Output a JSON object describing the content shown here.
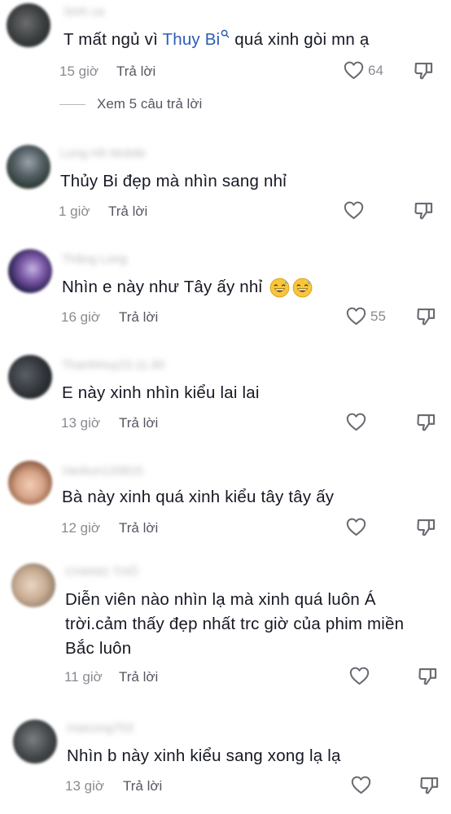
{
  "comments": [
    {
      "username": "Sinh ca",
      "text_before": "T mất ngủ vì ",
      "mention": "Thuy Bi",
      "text_after": " quá xinh gòi mn ạ",
      "time": "15 giờ",
      "reply_label": "Trả lời",
      "likes": "64",
      "view_replies": "Xem 5 câu trả lời"
    },
    {
      "username": "Long Hồ Mobile",
      "text": "Thủy Bi đẹp mà nhìn sang nhỉ",
      "time": "1 giờ",
      "reply_label": "Trả lời",
      "likes": ""
    },
    {
      "username": "Thăng Long",
      "text": "Nhìn e này như Tây ấy nhỉ",
      "emojis": [
        "grinning-sweat-emoji",
        "grinning-sweat-emoji"
      ],
      "time": "16 giờ",
      "reply_label": "Trả lời",
      "likes": "55"
    },
    {
      "username": "ThanhHuy23.11.90",
      "text": "E này xinh nhìn kiểu lai lai",
      "time": "13 giờ",
      "reply_label": "Trả lời",
      "likes": ""
    },
    {
      "username": "Vankun120815",
      "text": "Bà này xinh quá xinh kiểu tây tây ấy",
      "time": "12 giờ",
      "reply_label": "Trả lời",
      "likes": ""
    },
    {
      "username": "CHANG THỎ",
      "text_lines": [
        "Diễn viên nào nhìn lạ mà xinh quá luôn Á",
        "trời.cảm thấy đẹp nhất trc giờ của phim miền",
        "Bắc luôn"
      ],
      "time": "11 giờ",
      "reply_label": "Trả lời",
      "likes": ""
    },
    {
      "username": "maicong753",
      "text": "Nhìn b này xinh kiểu sang xong lạ lạ",
      "time": "13 giờ",
      "reply_label": "Trả lời",
      "likes": ""
    }
  ],
  "colors": {
    "mention": "#2b5db8",
    "text": "#161823",
    "meta": "#8a8b91"
  }
}
